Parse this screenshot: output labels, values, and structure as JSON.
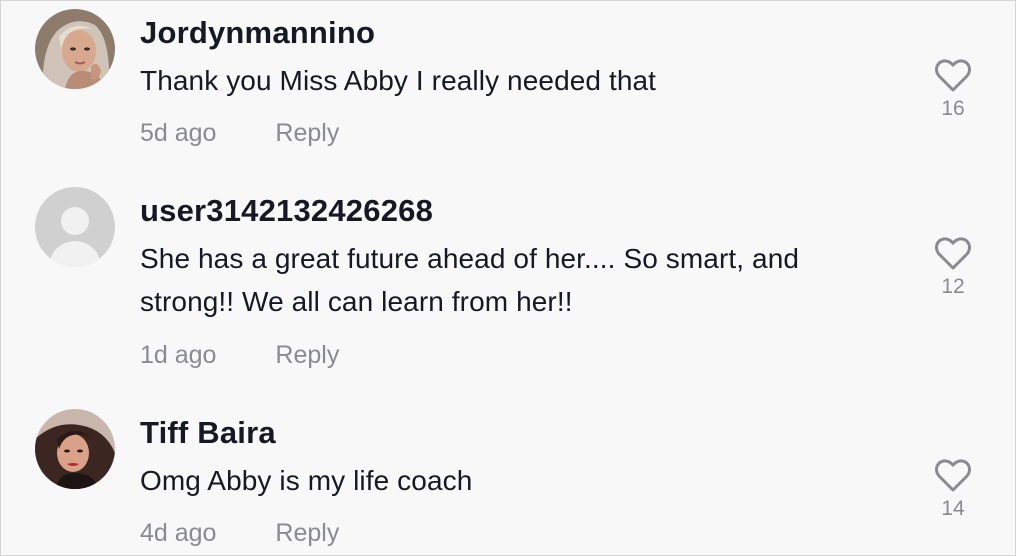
{
  "comments": [
    {
      "username": "Jordynmannino",
      "text": "Thank you Miss Abby I really needed that",
      "time": "5d ago",
      "reply_label": "Reply",
      "likes": "16",
      "avatar": "photo"
    },
    {
      "username": "user3142132426268",
      "text": "She has a great future ahead of her.... So smart, and strong!! We all can learn from her!!",
      "time": "1d ago",
      "reply_label": "Reply",
      "likes": "12",
      "avatar": "default-user-icon"
    },
    {
      "username": "Tiff Baira",
      "text": "Omg Abby is my life coach",
      "time": "4d ago",
      "reply_label": "Reply",
      "likes": "14",
      "avatar": "photo"
    }
  ],
  "colors": {
    "background": "#f8f8f8",
    "primary_text": "#161823",
    "secondary_text": "#8a8b91",
    "heart_outline": "#8a8b91"
  },
  "icons": [
    "heart-outline-icon",
    "default-user-icon"
  ]
}
